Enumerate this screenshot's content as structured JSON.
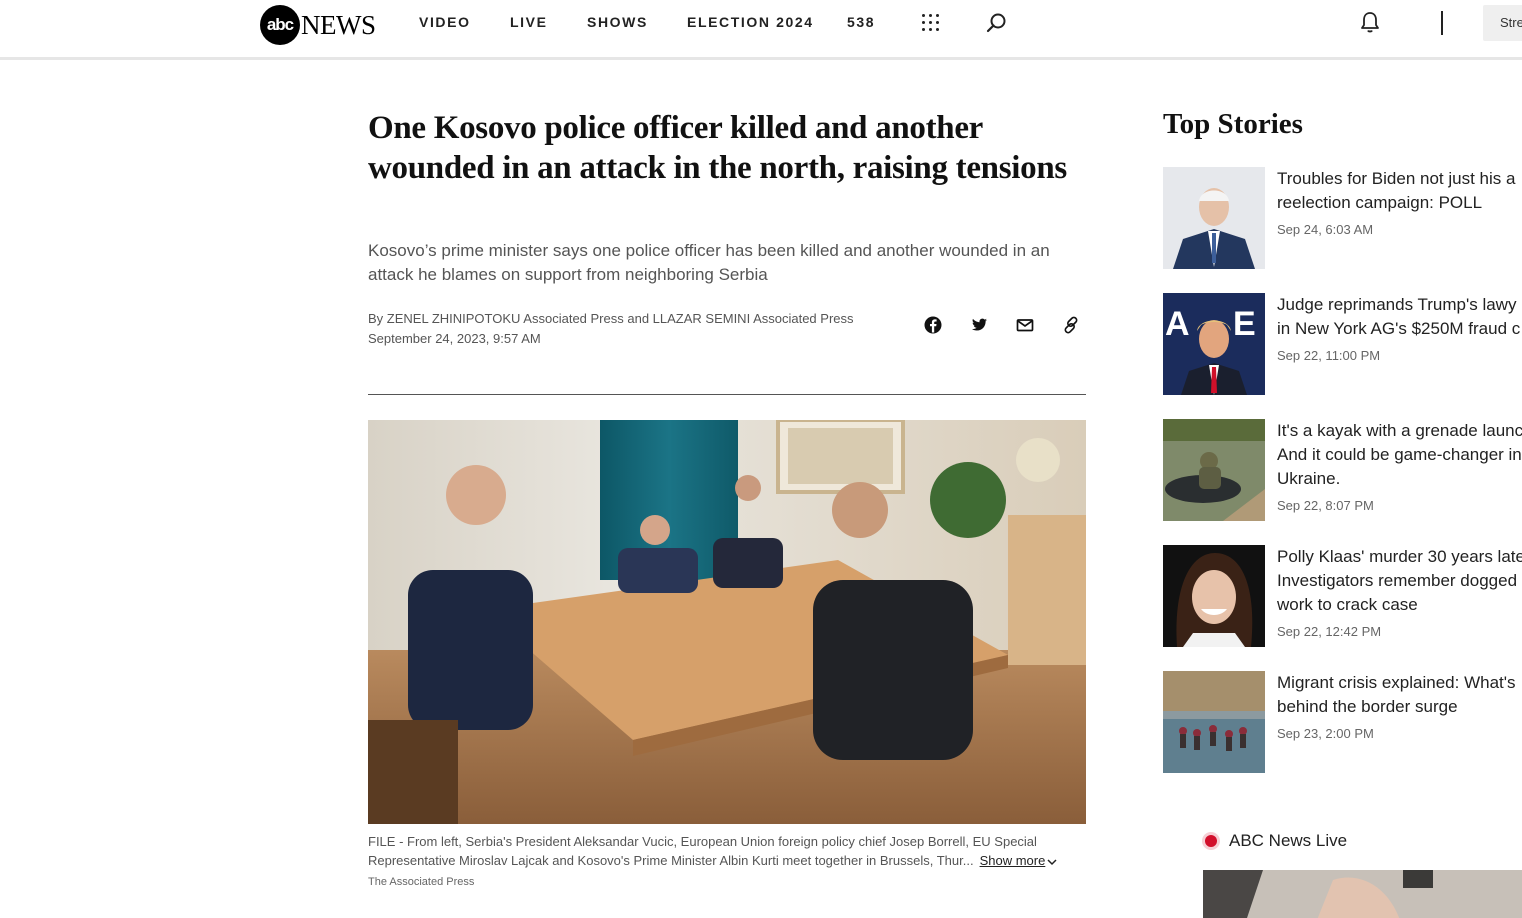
{
  "header": {
    "logo_abc": "abc",
    "logo_news": "NEWS",
    "nav": [
      "VIDEO",
      "LIVE",
      "SHOWS",
      "ELECTION 2024",
      "538"
    ],
    "stream_label": "Stream"
  },
  "article": {
    "headline": "One Kosovo police officer killed and another wounded in an attack in the north, raising tensions",
    "dek": "Kosovo’s prime minister says one police officer has been killed and another wounded in an attack he blames on support from neighboring Serbia",
    "byline": "By ZENEL ZHINIPOTOKU Associated Press and LLAZAR SEMINI Associated Press",
    "date": "September 24, 2023, 9:57 AM",
    "caption": "FILE - From left, Serbia's President Aleksandar Vucic, European Union foreign policy chief Josep Borrell, EU Special Representative Miroslav Lajcak and Kosovo's Prime Minister Albin Kurti meet together in Brussels, Thur...",
    "show_more": "Show more",
    "credit": "The Associated Press"
  },
  "sidebar": {
    "title": "Top Stories",
    "stories": [
      {
        "title_lines": [
          "Troubles for Biden not just his a",
          "reelection campaign: POLL"
        ],
        "time": "Sep 24, 6:03 AM"
      },
      {
        "title_lines": [
          "Judge reprimands Trump's lawy",
          "in New York AG's $250M fraud c"
        ],
        "time": "Sep 22, 11:00 PM"
      },
      {
        "title_lines": [
          "It's a kayak with a grenade launc",
          "And it could be game-changer in",
          "Ukraine."
        ],
        "time": "Sep 22, 8:07 PM"
      },
      {
        "title_lines": [
          "Polly Klaas' murder 30 years late",
          "Investigators remember dogged",
          "work to crack case"
        ],
        "time": "Sep 22, 12:42 PM"
      },
      {
        "title_lines": [
          "Migrant crisis explained: What's",
          "behind the border surge"
        ],
        "time": "Sep 23, 2:00 PM"
      }
    ],
    "live_label": "ABC News Live"
  }
}
